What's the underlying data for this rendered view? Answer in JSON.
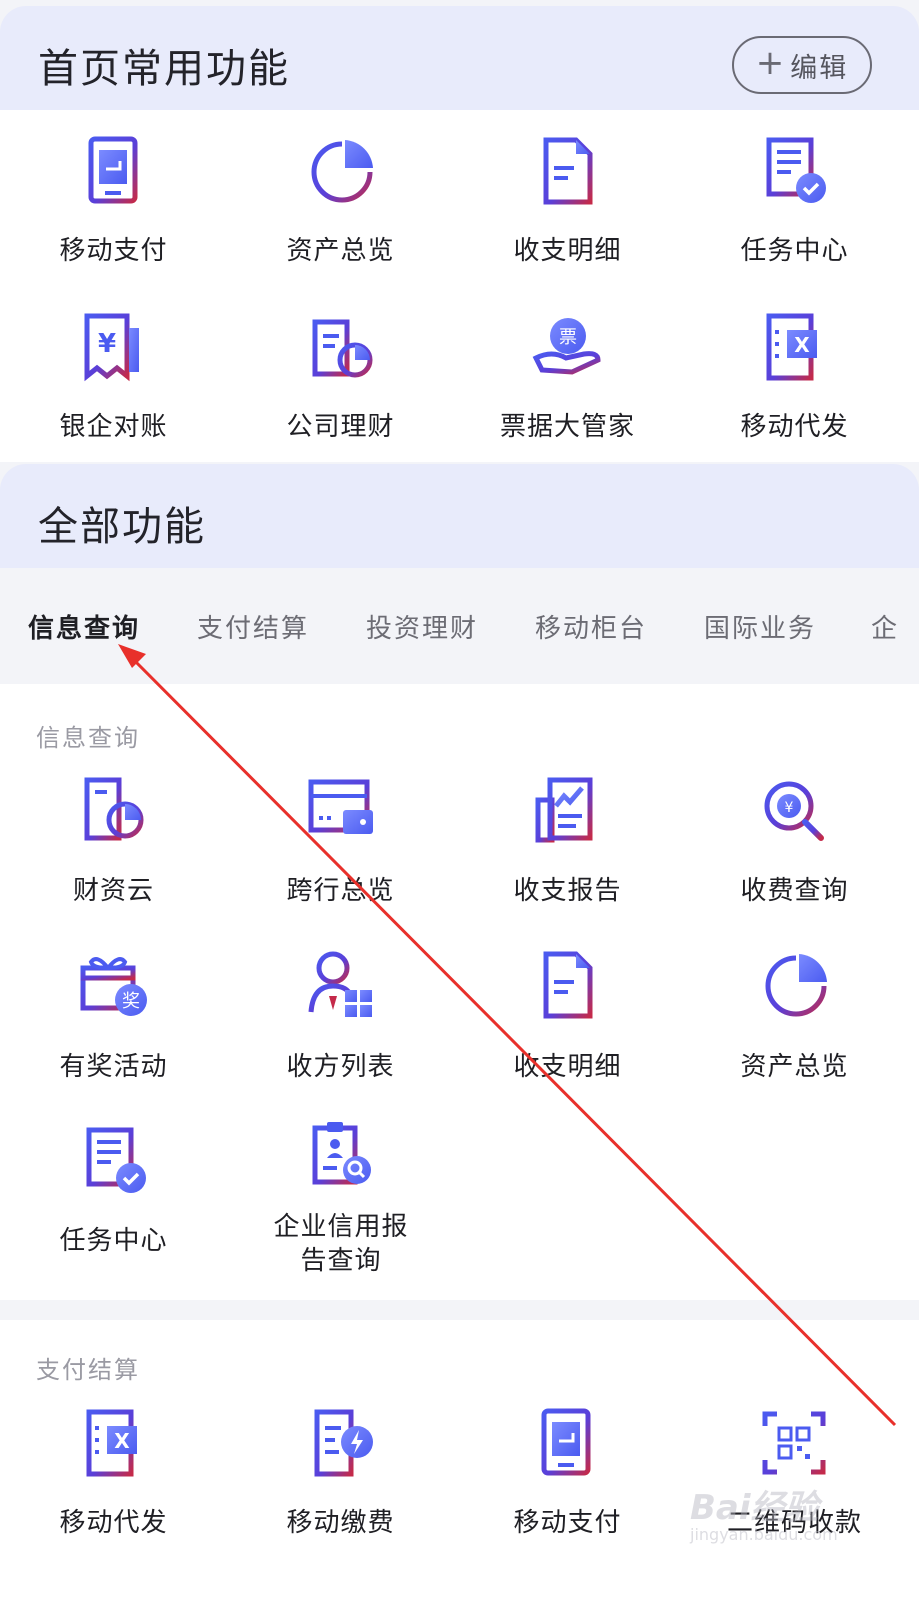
{
  "home": {
    "title": "首页常用功能",
    "edit": {
      "icon": "plus-icon",
      "label": "编辑"
    },
    "items": [
      {
        "label": "移动支付",
        "icon": "mobile-pay-icon"
      },
      {
        "label": "资产总览",
        "icon": "pie-chart-icon"
      },
      {
        "label": "收支明细",
        "icon": "document-icon"
      },
      {
        "label": "任务中心",
        "icon": "task-check-icon"
      },
      {
        "label": "银企对账",
        "icon": "yen-receipt-icon"
      },
      {
        "label": "公司理财",
        "icon": "finance-doc-icon"
      },
      {
        "label": "票据大管家",
        "icon": "bill-hand-icon"
      },
      {
        "label": "移动代发",
        "icon": "excel-doc-icon"
      }
    ]
  },
  "all": {
    "title": "全部功能",
    "tabs": [
      {
        "label": "信息查询",
        "active": true
      },
      {
        "label": "支付结算",
        "active": false
      },
      {
        "label": "投资理财",
        "active": false
      },
      {
        "label": "移动柜台",
        "active": false
      },
      {
        "label": "国际业务",
        "active": false
      },
      {
        "label": "企",
        "active": false
      }
    ],
    "sections": [
      {
        "title": "信息查询",
        "items": [
          {
            "label": "财资云",
            "icon": "cloud-finance-icon"
          },
          {
            "label": "跨行总览",
            "icon": "wallet-card-icon"
          },
          {
            "label": "收支报告",
            "icon": "report-chart-icon"
          },
          {
            "label": "收费查询",
            "icon": "fee-search-icon"
          },
          {
            "label": "有奖活动",
            "icon": "gift-reward-icon"
          },
          {
            "label": "收方列表",
            "icon": "payee-list-icon"
          },
          {
            "label": "收支明细",
            "icon": "document-icon"
          },
          {
            "label": "资产总览",
            "icon": "pie-chart-icon"
          },
          {
            "label": "任务中心",
            "icon": "task-check-icon"
          },
          {
            "label": "企业信用报告查询",
            "icon": "credit-report-icon"
          }
        ]
      },
      {
        "title": "支付结算",
        "items": [
          {
            "label": "移动代发",
            "icon": "excel-doc-icon"
          },
          {
            "label": "移动缴费",
            "icon": "bolt-pay-icon"
          },
          {
            "label": "移动支付",
            "icon": "mobile-pay-icon"
          },
          {
            "label": "二维码收款",
            "icon": "qr-code-icon"
          }
        ]
      }
    ]
  },
  "colors": {
    "accent_blue": "#4b5bf0",
    "accent_purple": "#6a3fe0",
    "accent_red": "#c42a4a",
    "header_bg": "#e8ebfb",
    "arrow": "#e8302b"
  },
  "watermark": {
    "main": "Bai经验",
    "sub": "jingyan.baidu.com"
  }
}
